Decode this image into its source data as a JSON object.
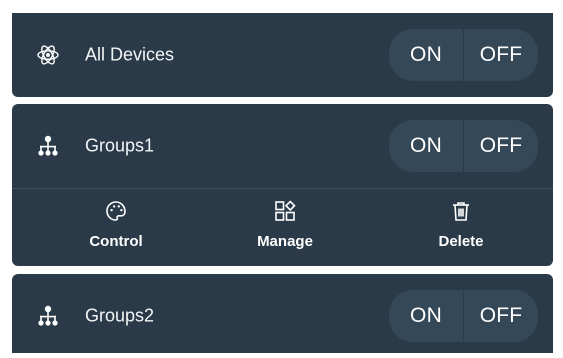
{
  "rows": [
    {
      "icon": "atom-icon",
      "label": "All Devices",
      "on_label": "ON",
      "off_label": "OFF"
    },
    {
      "icon": "network-icon",
      "label": "Groups1",
      "on_label": "ON",
      "off_label": "OFF"
    },
    {
      "icon": "network-icon",
      "label": "Groups2",
      "on_label": "ON",
      "off_label": "OFF"
    }
  ],
  "group1_actions": [
    {
      "icon": "palette-icon",
      "label": "Control"
    },
    {
      "icon": "apps-icon",
      "label": "Manage"
    },
    {
      "icon": "trash-icon",
      "label": "Delete"
    }
  ],
  "colors": {
    "panel": "#2a3a48",
    "toggle": "#354857",
    "text": "#ffffff"
  }
}
